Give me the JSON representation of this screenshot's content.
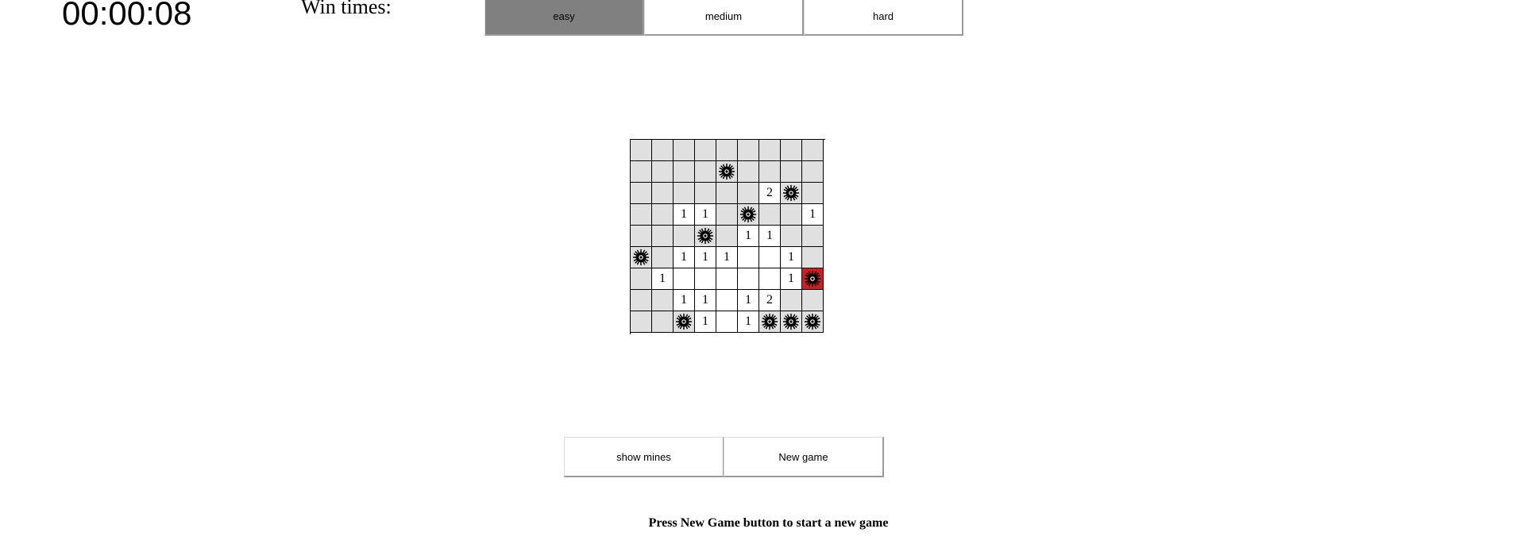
{
  "timer": "00:00:08",
  "win_times_label": "Win times:",
  "difficulty": {
    "easy": "easy",
    "medium": "medium",
    "hard": "hard",
    "selected": "easy"
  },
  "board": {
    "rows": 9,
    "cols": 9,
    "cells": [
      [
        "h",
        "h",
        "h",
        "h",
        "h",
        "h",
        "h",
        "h",
        "h"
      ],
      [
        "h",
        "h",
        "h",
        "h",
        "m",
        "h",
        "h",
        "h",
        "h"
      ],
      [
        "h",
        "h",
        "h",
        "h",
        "h",
        "h",
        "2",
        "m",
        "h"
      ],
      [
        "h",
        "h",
        "1",
        "1",
        "h",
        "m",
        "h",
        "h",
        "1"
      ],
      [
        "h",
        "h",
        "h",
        "m",
        "h",
        "1",
        "1",
        "h",
        "h"
      ],
      [
        "m",
        "h",
        "1",
        "1",
        "1",
        "o",
        "o",
        "1",
        "h"
      ],
      [
        "h",
        "1",
        "o",
        "o",
        "o",
        "o",
        "o",
        "1",
        "x"
      ],
      [
        "h",
        "h",
        "1",
        "1",
        "o",
        "1",
        "2",
        "h",
        "h"
      ],
      [
        "h",
        "h",
        "m",
        "1",
        "o",
        "1",
        "m",
        "m",
        "m"
      ]
    ]
  },
  "buttons": {
    "show_mines": "show mines",
    "new_game": "New game"
  },
  "status_message": "Press New Game button to start a new game",
  "colors": {
    "hidden_cell": "#e0e0e0",
    "open_cell": "#ffffff",
    "exploded_cell": "#cc1f1f",
    "selected_difficulty": "#808080"
  }
}
